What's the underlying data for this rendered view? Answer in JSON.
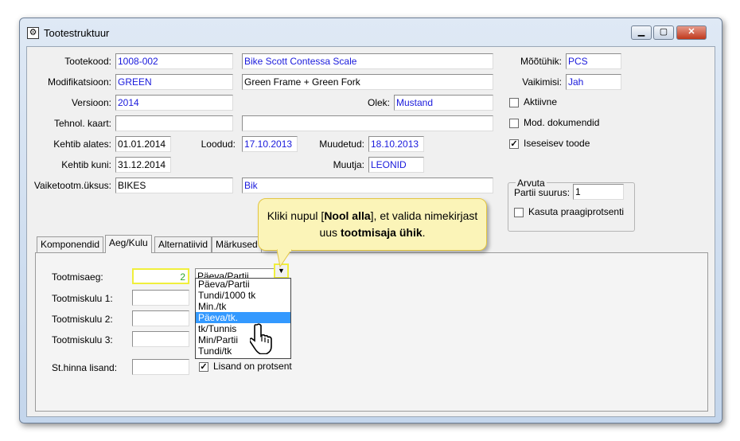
{
  "window": {
    "title": "Tootestruktuur",
    "min": "▁",
    "max": "▢",
    "close": "✕"
  },
  "form": {
    "tootekood": {
      "label": "Tootekood:",
      "code": "1008-002",
      "name": "Bike Scott Contessa Scale"
    },
    "modifikatsioon": {
      "label": "Modifikatsioon:",
      "code": "GREEN",
      "name": "Green Frame + Green Fork"
    },
    "versioon": {
      "label": "Versioon:",
      "value": "2014"
    },
    "olek": {
      "label": "Olek:",
      "value": "Mustand"
    },
    "tehnol": {
      "label": "Tehnol. kaart:",
      "value": "",
      "value2": ""
    },
    "kehtib_alates": {
      "label": "Kehtib alates:",
      "value": "01.01.2014"
    },
    "loodud": {
      "label": "Loodud:",
      "value": "17.10.2013"
    },
    "muudetud": {
      "label": "Muudetud:",
      "value": "18.10.2013"
    },
    "kehtib_kuni": {
      "label": "Kehtib kuni:",
      "value": "31.12.2014"
    },
    "muutja": {
      "label": "Muutja:",
      "value": "LEONID"
    },
    "vaiketootm": {
      "label": "Vaiketootm.üksus:",
      "value": "BIKES",
      "value2": "Bik"
    },
    "mootuhik": {
      "label": "Mõõtühik:",
      "value": "PCS"
    },
    "vaikimisi": {
      "label": "Vaikimisi:",
      "value": "Jah"
    },
    "aktiivne": {
      "label": "Aktiivne",
      "checked": ""
    },
    "mod_dok": {
      "label": "Mod. dokumendid",
      "checked": ""
    },
    "iseseisev": {
      "label": "Iseseisev toode",
      "checked": "✓"
    },
    "arvuta": {
      "title": "Arvuta",
      "partii_label": "Partii suurus:",
      "partii_value": "1",
      "kasuta_label": "Kasuta praagiprotsenti",
      "kasuta_checked": ""
    }
  },
  "tabs": [
    "Komponendid",
    "Aeg/Kulu",
    "Alternatiivid",
    "Märkused"
  ],
  "panel": {
    "tootmisaeg": {
      "label": "Tootmisaeg:",
      "value": "2",
      "unit": "Päeva/Partii"
    },
    "kulu1": {
      "label": "Tootmiskulu 1:",
      "value": ""
    },
    "kulu2": {
      "label": "Tootmiskulu 2:",
      "value": ""
    },
    "kulu3": {
      "label": "Tootmiskulu 3:",
      "value": ""
    },
    "sthinna": {
      "label": "St.hinna lisand:",
      "value": "",
      "check": "✓",
      "check_label": "Lisand on protsent"
    },
    "dropdown_arrow": "▼",
    "options": [
      "Päeva/Partii",
      "Tundi/1000 tk",
      "Min./tk",
      "Päeva/tk.",
      "tk/Tunnis",
      "Min/Partii",
      "Tundi/tk"
    ],
    "selected_index": 3
  },
  "callout": {
    "pre": "Kliki nupul [",
    "bold1": "Nool alla",
    "mid": "], et valida nimekirjast uus ",
    "bold2": "tootmisaja ühik",
    "post": "."
  },
  "colors": {
    "highlight": "#f0ef3c",
    "callout_bg": "#fbf4b8",
    "selection": "#3399ff",
    "value_text": "#1a1adc"
  },
  "icons": {
    "app": "structure-icon",
    "cursor": "hand-pointer-icon"
  }
}
